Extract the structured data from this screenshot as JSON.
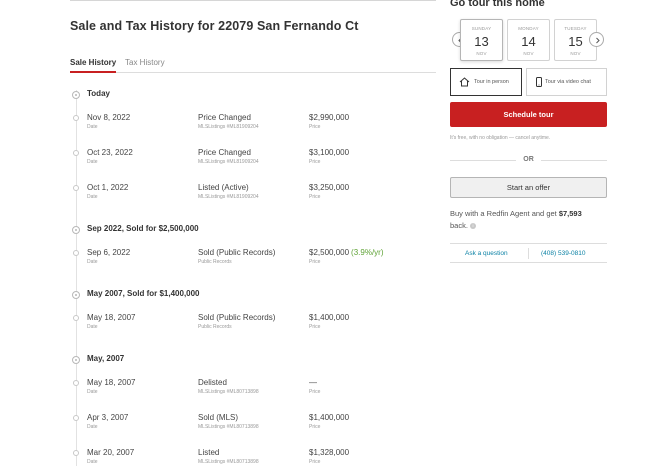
{
  "history": {
    "title": "Sale and Tax History for 22079 San Fernando Ct",
    "tabs": [
      {
        "label": "Sale History"
      },
      {
        "label": "Tax History"
      }
    ],
    "groups": [
      {
        "label": "Today",
        "events": [
          {
            "date": "Nov 8, 2022",
            "date_label": "Date",
            "event": "Price Changed",
            "source": "MLSListings #ML81909204",
            "price": "$2,990,000",
            "appreciation": "",
            "price_label": "Price"
          },
          {
            "date": "Oct 23, 2022",
            "date_label": "Date",
            "event": "Price Changed",
            "source": "MLSListings #ML81909204",
            "price": "$3,100,000",
            "appreciation": "",
            "price_label": "Price"
          },
          {
            "date": "Oct 1, 2022",
            "date_label": "Date",
            "event": "Listed (Active)",
            "source": "MLSListings #ML81909204",
            "price": "$3,250,000",
            "appreciation": "",
            "price_label": "Price"
          }
        ]
      },
      {
        "label": "Sep 2022, Sold for $2,500,000",
        "events": [
          {
            "date": "Sep 6, 2022",
            "date_label": "Date",
            "event": "Sold (Public Records)",
            "source": "Public Records",
            "price": "$2,500,000",
            "appreciation": "(3.9%/yr)",
            "price_label": "Price"
          }
        ]
      },
      {
        "label": "May 2007, Sold for $1,400,000",
        "events": [
          {
            "date": "May 18, 2007",
            "date_label": "Date",
            "event": "Sold (Public Records)",
            "source": "Public Records",
            "price": "$1,400,000",
            "appreciation": "",
            "price_label": "Price"
          }
        ]
      },
      {
        "label": "May, 2007",
        "events": [
          {
            "date": "May 18, 2007",
            "date_label": "Date",
            "event": "Delisted",
            "source": "MLSListings #ML80713898",
            "price": "—",
            "appreciation": "",
            "price_label": "Price"
          },
          {
            "date": "Apr 3, 2007",
            "date_label": "Date",
            "event": "Sold (MLS)",
            "source": "MLSListings #ML80713898",
            "price": "$1,400,000",
            "appreciation": "",
            "price_label": "Price"
          },
          {
            "date": "Mar 20, 2007",
            "date_label": "Date",
            "event": "Listed",
            "source": "MLSListings #ML80713898",
            "price": "$1,328,000",
            "appreciation": "",
            "price_label": "Price"
          }
        ]
      }
    ]
  },
  "tour": {
    "title": "Go tour this home",
    "prev_icon": "chevron-left-icon",
    "next_icon": "chevron-right-icon",
    "dates": [
      {
        "day": "SUNDAY",
        "num": "13",
        "month": "NOV",
        "selected": true
      },
      {
        "day": "MONDAY",
        "num": "14",
        "month": "NOV",
        "selected": false
      },
      {
        "day": "TUESDAY",
        "num": "15",
        "month": "NOV",
        "selected": false
      }
    ],
    "types": [
      {
        "label": "Tour in person",
        "icon": "house-icon",
        "selected": true
      },
      {
        "label": "Tour via video chat",
        "icon": "phone-icon",
        "selected": false
      }
    ],
    "schedule_label": "Schedule tour",
    "disclaimer": "It's free, with no obligation — cancel anytime.",
    "or_label": "OR",
    "offer_label": "Start an offer",
    "agent_text_prefix": "Buy with a Redfin Agent and get ",
    "agent_amount": "$7,593",
    "agent_text_suffix": "back.",
    "ask_label": "Ask a question",
    "phone": "(408) 539-0810"
  },
  "colors": {
    "brand_red": "#c82021",
    "link_blue": "#0c82a5",
    "appreciation_green": "#5fa336"
  }
}
